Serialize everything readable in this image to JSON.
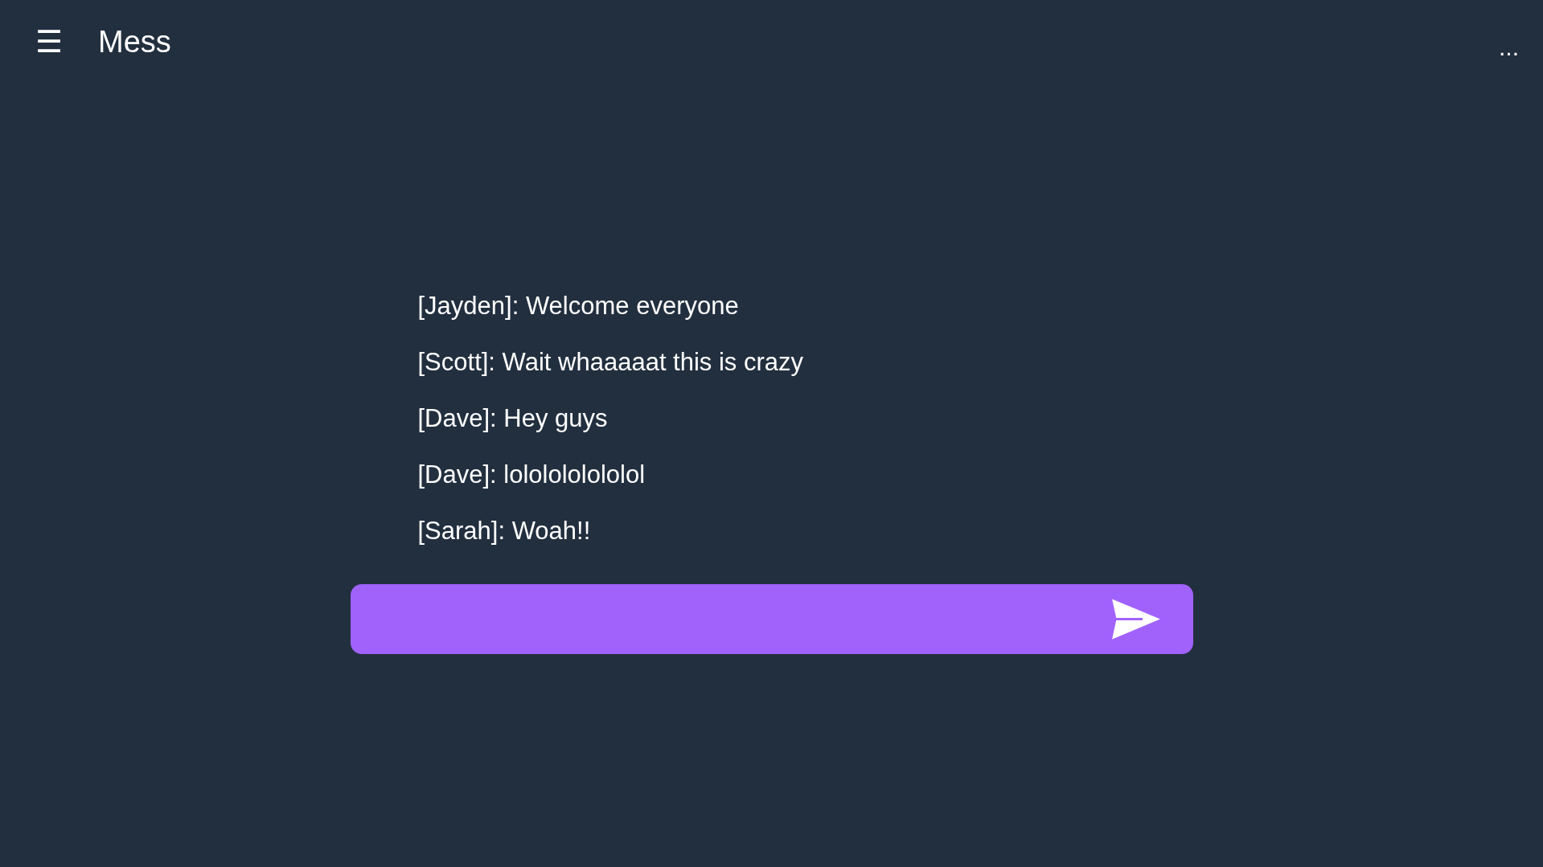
{
  "header": {
    "menu_icon": "☰",
    "title": "Mess",
    "more": "..."
  },
  "messages": [
    {
      "text": "[Jayden]: Welcome everyone"
    },
    {
      "text": "[Scott]: Wait whaaaaat this is crazy"
    },
    {
      "text": "[Dave]: Hey guys"
    },
    {
      "text": "[Dave]: lololololololol"
    },
    {
      "text": "[Sarah]: Woah!!"
    }
  ]
}
